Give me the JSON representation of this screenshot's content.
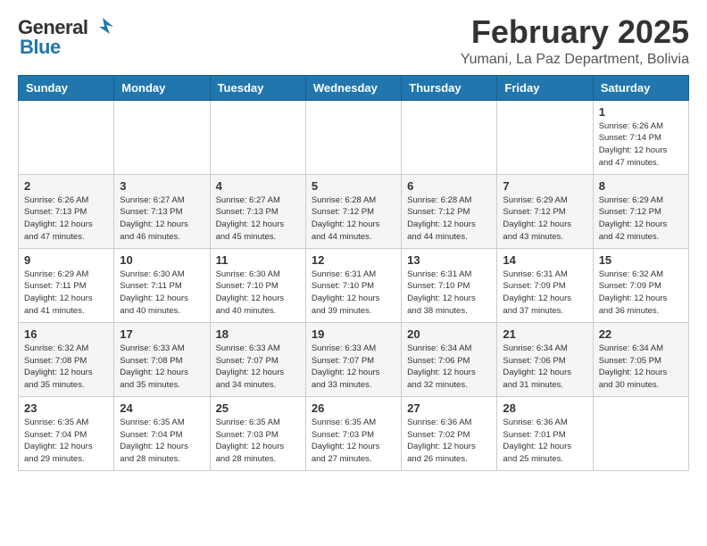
{
  "header": {
    "logo_general": "General",
    "logo_blue": "Blue",
    "month_title": "February 2025",
    "location": "Yumani, La Paz Department, Bolivia"
  },
  "days_of_week": [
    "Sunday",
    "Monday",
    "Tuesday",
    "Wednesday",
    "Thursday",
    "Friday",
    "Saturday"
  ],
  "weeks": [
    [
      {
        "day": "",
        "info": ""
      },
      {
        "day": "",
        "info": ""
      },
      {
        "day": "",
        "info": ""
      },
      {
        "day": "",
        "info": ""
      },
      {
        "day": "",
        "info": ""
      },
      {
        "day": "",
        "info": ""
      },
      {
        "day": "1",
        "info": "Sunrise: 6:26 AM\nSunset: 7:14 PM\nDaylight: 12 hours\nand 47 minutes."
      }
    ],
    [
      {
        "day": "2",
        "info": "Sunrise: 6:26 AM\nSunset: 7:13 PM\nDaylight: 12 hours\nand 47 minutes."
      },
      {
        "day": "3",
        "info": "Sunrise: 6:27 AM\nSunset: 7:13 PM\nDaylight: 12 hours\nand 46 minutes."
      },
      {
        "day": "4",
        "info": "Sunrise: 6:27 AM\nSunset: 7:13 PM\nDaylight: 12 hours\nand 45 minutes."
      },
      {
        "day": "5",
        "info": "Sunrise: 6:28 AM\nSunset: 7:12 PM\nDaylight: 12 hours\nand 44 minutes."
      },
      {
        "day": "6",
        "info": "Sunrise: 6:28 AM\nSunset: 7:12 PM\nDaylight: 12 hours\nand 44 minutes."
      },
      {
        "day": "7",
        "info": "Sunrise: 6:29 AM\nSunset: 7:12 PM\nDaylight: 12 hours\nand 43 minutes."
      },
      {
        "day": "8",
        "info": "Sunrise: 6:29 AM\nSunset: 7:12 PM\nDaylight: 12 hours\nand 42 minutes."
      }
    ],
    [
      {
        "day": "9",
        "info": "Sunrise: 6:29 AM\nSunset: 7:11 PM\nDaylight: 12 hours\nand 41 minutes."
      },
      {
        "day": "10",
        "info": "Sunrise: 6:30 AM\nSunset: 7:11 PM\nDaylight: 12 hours\nand 40 minutes."
      },
      {
        "day": "11",
        "info": "Sunrise: 6:30 AM\nSunset: 7:10 PM\nDaylight: 12 hours\nand 40 minutes."
      },
      {
        "day": "12",
        "info": "Sunrise: 6:31 AM\nSunset: 7:10 PM\nDaylight: 12 hours\nand 39 minutes."
      },
      {
        "day": "13",
        "info": "Sunrise: 6:31 AM\nSunset: 7:10 PM\nDaylight: 12 hours\nand 38 minutes."
      },
      {
        "day": "14",
        "info": "Sunrise: 6:31 AM\nSunset: 7:09 PM\nDaylight: 12 hours\nand 37 minutes."
      },
      {
        "day": "15",
        "info": "Sunrise: 6:32 AM\nSunset: 7:09 PM\nDaylight: 12 hours\nand 36 minutes."
      }
    ],
    [
      {
        "day": "16",
        "info": "Sunrise: 6:32 AM\nSunset: 7:08 PM\nDaylight: 12 hours\nand 35 minutes."
      },
      {
        "day": "17",
        "info": "Sunrise: 6:33 AM\nSunset: 7:08 PM\nDaylight: 12 hours\nand 35 minutes."
      },
      {
        "day": "18",
        "info": "Sunrise: 6:33 AM\nSunset: 7:07 PM\nDaylight: 12 hours\nand 34 minutes."
      },
      {
        "day": "19",
        "info": "Sunrise: 6:33 AM\nSunset: 7:07 PM\nDaylight: 12 hours\nand 33 minutes."
      },
      {
        "day": "20",
        "info": "Sunrise: 6:34 AM\nSunset: 7:06 PM\nDaylight: 12 hours\nand 32 minutes."
      },
      {
        "day": "21",
        "info": "Sunrise: 6:34 AM\nSunset: 7:06 PM\nDaylight: 12 hours\nand 31 minutes."
      },
      {
        "day": "22",
        "info": "Sunrise: 6:34 AM\nSunset: 7:05 PM\nDaylight: 12 hours\nand 30 minutes."
      }
    ],
    [
      {
        "day": "23",
        "info": "Sunrise: 6:35 AM\nSunset: 7:04 PM\nDaylight: 12 hours\nand 29 minutes."
      },
      {
        "day": "24",
        "info": "Sunrise: 6:35 AM\nSunset: 7:04 PM\nDaylight: 12 hours\nand 28 minutes."
      },
      {
        "day": "25",
        "info": "Sunrise: 6:35 AM\nSunset: 7:03 PM\nDaylight: 12 hours\nand 28 minutes."
      },
      {
        "day": "26",
        "info": "Sunrise: 6:35 AM\nSunset: 7:03 PM\nDaylight: 12 hours\nand 27 minutes."
      },
      {
        "day": "27",
        "info": "Sunrise: 6:36 AM\nSunset: 7:02 PM\nDaylight: 12 hours\nand 26 minutes."
      },
      {
        "day": "28",
        "info": "Sunrise: 6:36 AM\nSunset: 7:01 PM\nDaylight: 12 hours\nand 25 minutes."
      },
      {
        "day": "",
        "info": ""
      }
    ]
  ]
}
